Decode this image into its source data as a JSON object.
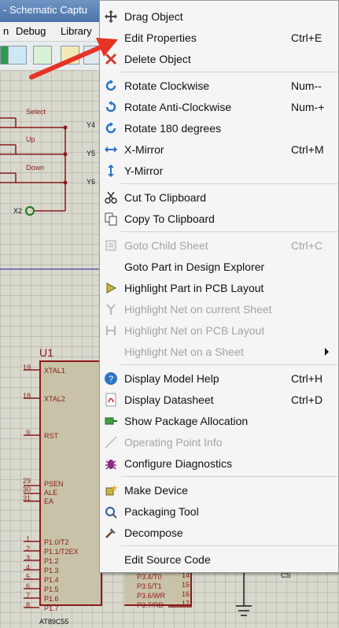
{
  "window": {
    "title": "- Schematic Captu",
    "menus": [
      "n",
      "Debug",
      "Library"
    ]
  },
  "schematic": {
    "labels": {
      "select": "Select",
      "up": "Up",
      "down": "Down",
      "y4": "Y4",
      "y5": "Y5",
      "y6": "Y6",
      "x2": "X2",
      "u1": "U1",
      "chip_name": "AT89C55",
      "cs": "CS"
    },
    "left_pins": [
      {
        "num": "19",
        "name": "XTAL1"
      },
      {
        "num": "18",
        "name": "XTAL2"
      },
      {
        "num": "9",
        "name": "RST"
      },
      {
        "num": "29",
        "name": "PSEN"
      },
      {
        "num": "30",
        "name": "ALE"
      },
      {
        "num": "31",
        "name": "EA"
      },
      {
        "num": "1",
        "name": "P1.0/T2"
      },
      {
        "num": "2",
        "name": "P1.1/T2EX"
      },
      {
        "num": "3",
        "name": "P1.2"
      },
      {
        "num": "4",
        "name": "P1.3"
      },
      {
        "num": "5",
        "name": "P1.4"
      },
      {
        "num": "6",
        "name": "P1.5"
      },
      {
        "num": "7",
        "name": "P1.6"
      },
      {
        "num": "8",
        "name": "P1.7"
      }
    ],
    "right_pins": [
      {
        "num": "14",
        "name": "P3.4/T0"
      },
      {
        "num": "15",
        "name": "P3.5/T1"
      },
      {
        "num": "16",
        "name": "P3.6/WR"
      },
      {
        "num": "17",
        "name": "P3.7/RD"
      }
    ]
  },
  "context_menu": {
    "items": [
      {
        "label": "Drag Object",
        "shortcut": "",
        "icon": "move-icon",
        "disabled": false
      },
      {
        "label": "Edit Properties",
        "shortcut": "Ctrl+E",
        "icon": "",
        "disabled": false
      },
      {
        "label": "Delete Object",
        "shortcut": "",
        "icon": "delete-x-icon",
        "disabled": false
      },
      {
        "label": "Rotate Clockwise",
        "shortcut": "Num--",
        "icon": "rotate-clockwise-icon",
        "disabled": false
      },
      {
        "label": "Rotate Anti-Clockwise",
        "shortcut": "Num-+",
        "icon": "rotate-anticlockwise-icon",
        "disabled": false
      },
      {
        "label": "Rotate 180 degrees",
        "shortcut": "",
        "icon": "rotate-180-icon",
        "disabled": false
      },
      {
        "label": "X-Mirror",
        "shortcut": "Ctrl+M",
        "icon": "x-mirror-icon",
        "disabled": false
      },
      {
        "label": "Y-Mirror",
        "shortcut": "",
        "icon": "y-mirror-icon",
        "disabled": false
      },
      {
        "label": "Cut To Clipboard",
        "shortcut": "",
        "icon": "cut-icon",
        "disabled": false
      },
      {
        "label": "Copy To Clipboard",
        "shortcut": "",
        "icon": "copy-icon",
        "disabled": false
      },
      {
        "label": "Goto Child Sheet",
        "shortcut": "Ctrl+C",
        "icon": "child-sheet-icon",
        "disabled": true
      },
      {
        "label": "Goto Part in Design Explorer",
        "shortcut": "",
        "icon": "",
        "disabled": false
      },
      {
        "label": "Highlight Part in PCB Layout",
        "shortcut": "",
        "icon": "highlight-part-icon",
        "disabled": false
      },
      {
        "label": "Highlight Net on current Sheet",
        "shortcut": "",
        "icon": "net-current-icon",
        "disabled": true
      },
      {
        "label": "Highlight Net on PCB Layout",
        "shortcut": "",
        "icon": "net-pcb-icon",
        "disabled": true
      },
      {
        "label": "Highlight Net on a Sheet",
        "shortcut": "",
        "icon": "",
        "disabled": true,
        "submenu": true
      },
      {
        "label": "Display Model Help",
        "shortcut": "Ctrl+H",
        "icon": "help-icon",
        "disabled": false
      },
      {
        "label": "Display Datasheet",
        "shortcut": "Ctrl+D",
        "icon": "pdf-icon",
        "disabled": false
      },
      {
        "label": "Show Package Allocation",
        "shortcut": "",
        "icon": "package-icon",
        "disabled": false
      },
      {
        "label": "Operating Point Info",
        "shortcut": "",
        "icon": "operating-point-icon",
        "disabled": true
      },
      {
        "label": "Configure Diagnostics",
        "shortcut": "",
        "icon": "bug-icon",
        "disabled": false
      },
      {
        "label": "Make Device",
        "shortcut": "",
        "icon": "make-device-icon",
        "disabled": false
      },
      {
        "label": "Packaging Tool",
        "shortcut": "",
        "icon": "packaging-tool-icon",
        "disabled": false
      },
      {
        "label": "Decompose",
        "shortcut": "",
        "icon": "decompose-icon",
        "disabled": false
      },
      {
        "label": "Edit Source Code",
        "shortcut": "",
        "icon": "",
        "disabled": false
      }
    ]
  },
  "colors": {
    "accent": "#2b74c3",
    "schematic_red": "#8b1a1a",
    "pointer_red": "#e53325"
  }
}
